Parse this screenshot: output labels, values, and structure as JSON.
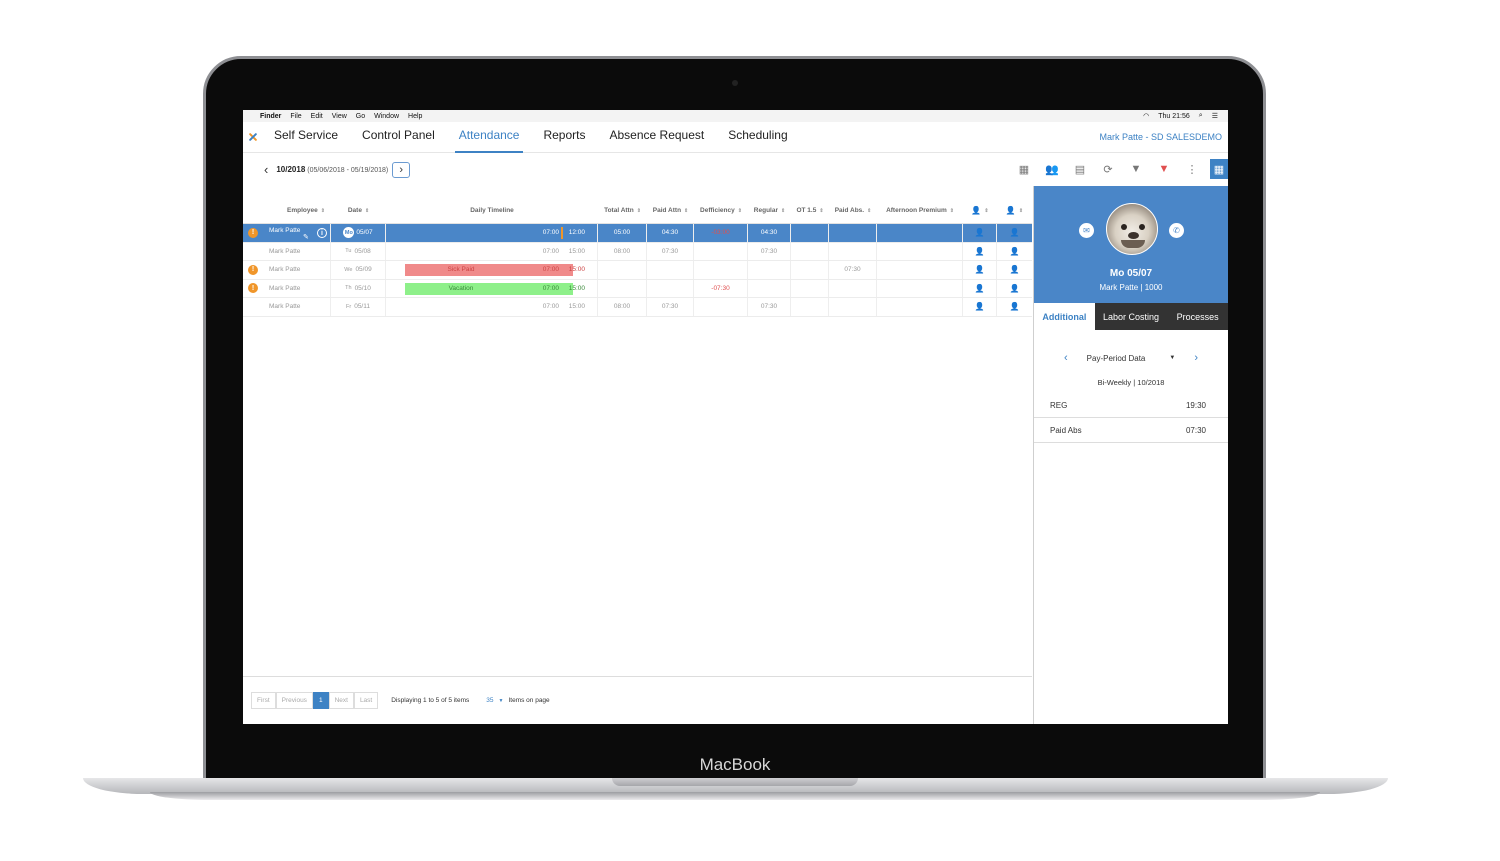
{
  "device": {
    "brand": "MacBook"
  },
  "menubar": {
    "items": [
      "Finder",
      "File",
      "Edit",
      "View",
      "Go",
      "Window",
      "Help"
    ],
    "clock": "Thu 21:56"
  },
  "nav": {
    "items": [
      "Self Service",
      "Control Panel",
      "Attendance",
      "Reports",
      "Absence Request",
      "Scheduling"
    ],
    "active": "Attendance",
    "user": "Mark Patte - SD SALESDEMO"
  },
  "period": {
    "label": "10/2018",
    "range": "(05/06/2018 - 05/19/2018)"
  },
  "columns": {
    "employee": "Employee",
    "date": "Date",
    "timeline": "Daily Timeline",
    "total_attn": "Total Attn",
    "paid_attn": "Paid Attn",
    "deficiency": "Defficiency",
    "regular": "Regular",
    "ot": "OT 1.5",
    "paid_abs": "Paid Abs.",
    "afternoon": "Afternoon Premium"
  },
  "rows": [
    {
      "warn": true,
      "employee": "Mark Patte",
      "day": "Mo",
      "date": "05/07",
      "absence": "",
      "start": "07:00",
      "end": "12:00",
      "total_attn": "05:00",
      "paid_attn": "04:30",
      "deficiency": "-03:00",
      "regular": "04:30",
      "ot": "",
      "paid_abs": "",
      "afternoon": ""
    },
    {
      "warn": false,
      "employee": "Mark Patte",
      "day": "Tu",
      "date": "05/08",
      "absence": "",
      "start": "07:00",
      "end": "15:00",
      "total_attn": "08:00",
      "paid_attn": "07:30",
      "deficiency": "",
      "regular": "07:30",
      "ot": "",
      "paid_abs": "",
      "afternoon": ""
    },
    {
      "warn": true,
      "employee": "Mark Patte",
      "day": "We",
      "date": "05/09",
      "absence": "Sick Paid",
      "start": "07:00",
      "end": "15:00",
      "total_attn": "",
      "paid_attn": "",
      "deficiency": "",
      "regular": "",
      "ot": "",
      "paid_abs": "07:30",
      "afternoon": ""
    },
    {
      "warn": true,
      "employee": "Mark Patte",
      "day": "Th",
      "date": "05/10",
      "absence": "Vacation",
      "start": "07:00",
      "end": "15:00",
      "total_attn": "",
      "paid_attn": "",
      "deficiency": "-07:30",
      "regular": "",
      "ot": "",
      "paid_abs": "",
      "afternoon": ""
    },
    {
      "warn": false,
      "employee": "Mark Patte",
      "day": "Fr",
      "date": "05/11",
      "absence": "",
      "start": "07:00",
      "end": "15:00",
      "total_attn": "08:00",
      "paid_attn": "07:30",
      "deficiency": "",
      "regular": "07:30",
      "ot": "",
      "paid_abs": "",
      "afternoon": ""
    }
  ],
  "pager": {
    "first": "First",
    "previous": "Previous",
    "page": "1",
    "next": "Next",
    "last": "Last",
    "info": "Displaying 1 to 5 of 5 items",
    "page_size": "35",
    "page_size_label": "Items on page"
  },
  "side": {
    "date": "Mo 05/07",
    "user": "Mark Patte | 1000",
    "tabs": [
      "Additional",
      "Labor Costing",
      "Processes"
    ],
    "active_tab": "Additional",
    "selector": "Pay-Period Data",
    "subtitle": "Bi-Weekly | 10/2018",
    "values": [
      {
        "label": "REG",
        "value": "19:30"
      },
      {
        "label": "Paid Abs",
        "value": "07:30"
      }
    ]
  },
  "colors": {
    "accent": "#3d82c4",
    "selected_row": "#4a86c8",
    "sick_bar": "#f08a8a",
    "vacation_bar": "#8ef08a",
    "warning": "#f0962a",
    "person": "#9ac53b"
  }
}
